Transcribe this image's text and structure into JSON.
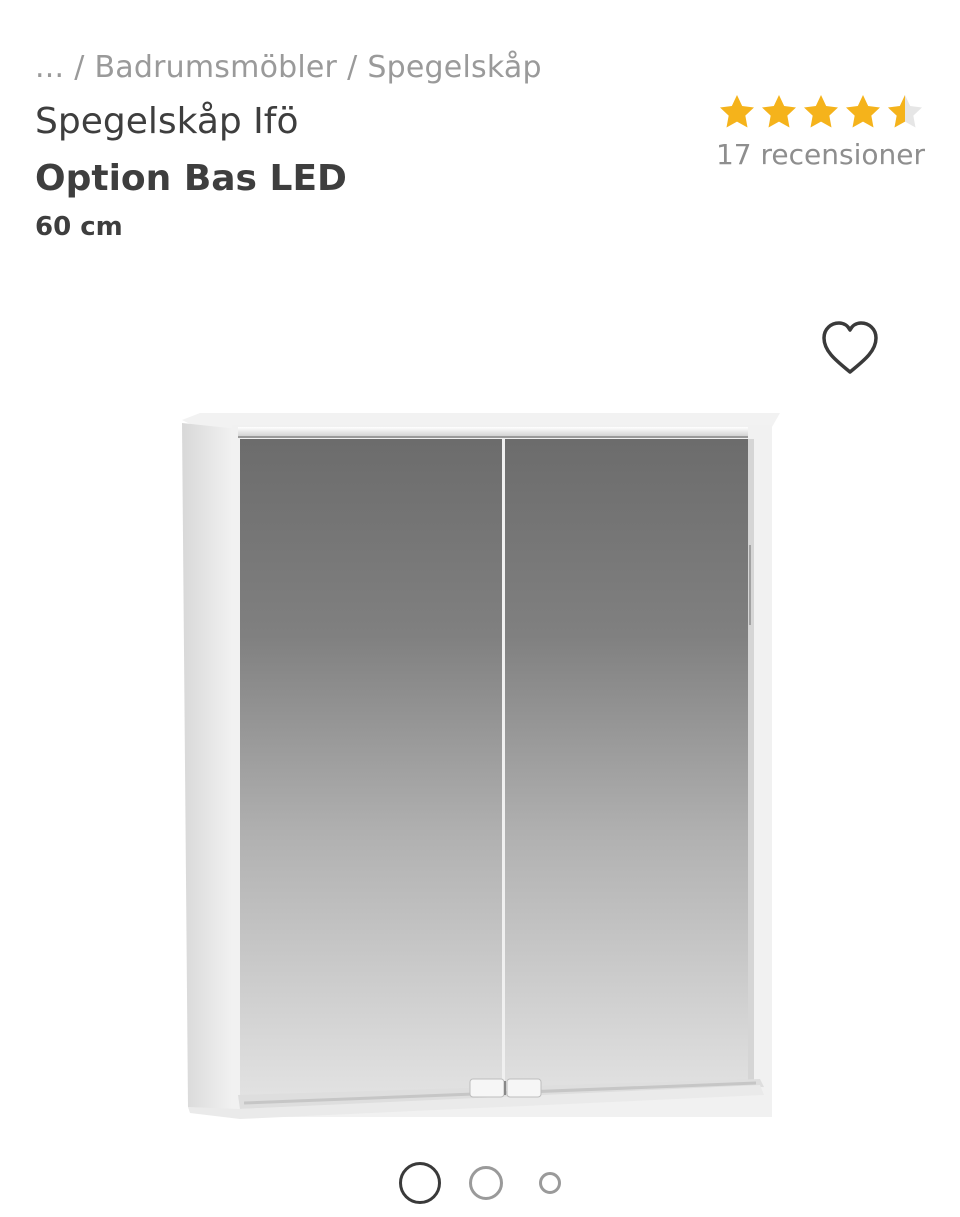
{
  "breadcrumb": {
    "items": [
      "...",
      "Badrumsmöbler",
      "Spegelskåp"
    ],
    "separator": "/"
  },
  "product": {
    "title_line1": "Spegelskåp Ifö",
    "title_line2": "Option Bas LED",
    "size": "60 cm",
    "image_icon": "mirror-cabinet-product-image"
  },
  "rating": {
    "value": 4.5,
    "max": 5,
    "review_count_text": "17 recensioner",
    "star_color": "#f5b31b",
    "empty_star_color": "#e6e6e6"
  },
  "favorite": {
    "icon": "heart-outline-icon"
  },
  "gallery": {
    "total_images": 3,
    "active_index": 0
  }
}
